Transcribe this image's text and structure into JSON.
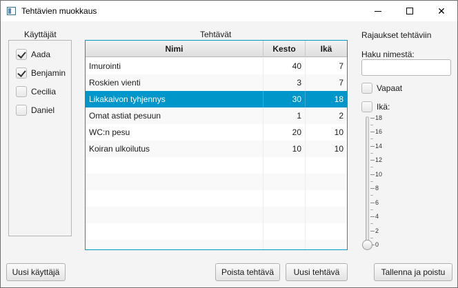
{
  "window": {
    "title": "Tehtävien muokkaus",
    "controls": {
      "minimize_icon": "minimize-icon",
      "maximize_icon": "maximize-icon",
      "close_icon": "close-icon",
      "close_glyph": "✕"
    }
  },
  "users": {
    "heading": "Käyttäjät",
    "items": [
      {
        "name": "Aada",
        "checked": true
      },
      {
        "name": "Benjamin",
        "checked": true
      },
      {
        "name": "Cecilia",
        "checked": false
      },
      {
        "name": "Daniel",
        "checked": false
      }
    ]
  },
  "tasks": {
    "heading": "Tehtävät",
    "columns": [
      "Nimi",
      "Kesto",
      "Ikä"
    ],
    "selected_index": 2,
    "selection_color": "#0096c9",
    "rows": [
      {
        "name": "Imurointi",
        "duration": "40",
        "age": "7"
      },
      {
        "name": "Roskien vienti",
        "duration": "3",
        "age": "7"
      },
      {
        "name": "Likakaivon tyhjennys",
        "duration": "30",
        "age": "18"
      },
      {
        "name": "Omat astiat pesuun",
        "duration": "1",
        "age": "2"
      },
      {
        "name": "WC:n pesu",
        "duration": "20",
        "age": "10"
      },
      {
        "name": "Koiran ulkoilutus",
        "duration": "10",
        "age": "10"
      }
    ]
  },
  "filters": {
    "heading": "Rajaukset tehtäviin",
    "search_label": "Haku nimestä:",
    "search_value": "",
    "free_label": "Vapaat",
    "free_checked": false,
    "age_label": "Ikä:",
    "age_checked": false,
    "age_slider": {
      "min": 0,
      "max": 18,
      "value": 0,
      "tick_labels": [
        "18",
        "16",
        "14",
        "12",
        "10",
        "8",
        "6",
        "4",
        "2",
        "0"
      ]
    }
  },
  "buttons": {
    "new_user": "Uusi käyttäjä",
    "delete_task": "Poista tehtävä",
    "new_task": "Uusi tehtävä",
    "save_exit": "Tallenna ja poistu"
  }
}
